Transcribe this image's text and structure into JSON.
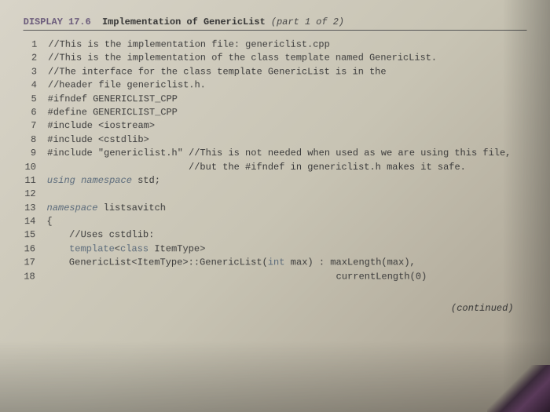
{
  "header": {
    "display_label": "DISPLAY",
    "display_number": "17.6",
    "title_main": "Implementation of",
    "title_code": "GenericList",
    "title_part": "(part 1 of 2)"
  },
  "code": {
    "lines": [
      {
        "n": "1",
        "text": "//This is the implementation file: genericlist.cpp"
      },
      {
        "n": "2",
        "text": "//This is the implementation of the class template named GenericList."
      },
      {
        "n": "3",
        "text": "//The interface for the class template GenericList is in the"
      },
      {
        "n": "4",
        "text": "//header file genericlist.h."
      },
      {
        "n": "5",
        "text": "#ifndef GENERICLIST_CPP"
      },
      {
        "n": "6",
        "text": "#define GENERICLIST_CPP"
      },
      {
        "n": "7",
        "text": "#include <iostream>"
      },
      {
        "n": "8",
        "text": "#include <cstdlib>"
      },
      {
        "n": "9",
        "text": "#include \"genericlist.h\" //This is not needed when used as we are using this file,"
      },
      {
        "n": "10",
        "text": "                         //but the #ifndef in genericlist.h makes it safe."
      },
      {
        "n": "11",
        "text_html": "<span class='kw-using'>using</span> <span class='kw-namespace'>namespace</span> std;"
      },
      {
        "n": "12",
        "text": ""
      },
      {
        "n": "13",
        "text_html": "<span class='kw-namespace'>namespace</span> listsavitch"
      },
      {
        "n": "14",
        "text": "{"
      },
      {
        "n": "15",
        "text": "    //Uses cstdlib:"
      },
      {
        "n": "16",
        "text_html": "    <span class='kw-template'>template</span>&lt;<span class='kw-class'>class</span> ItemType&gt;"
      },
      {
        "n": "17",
        "text_html": "    GenericList&lt;ItemType&gt;::GenericList(<span class='kw-int'>int</span> max) : maxLength(max),"
      },
      {
        "n": "18",
        "text": "                                                   currentLength(0)"
      }
    ]
  },
  "footer": {
    "continued": "(continued)"
  }
}
